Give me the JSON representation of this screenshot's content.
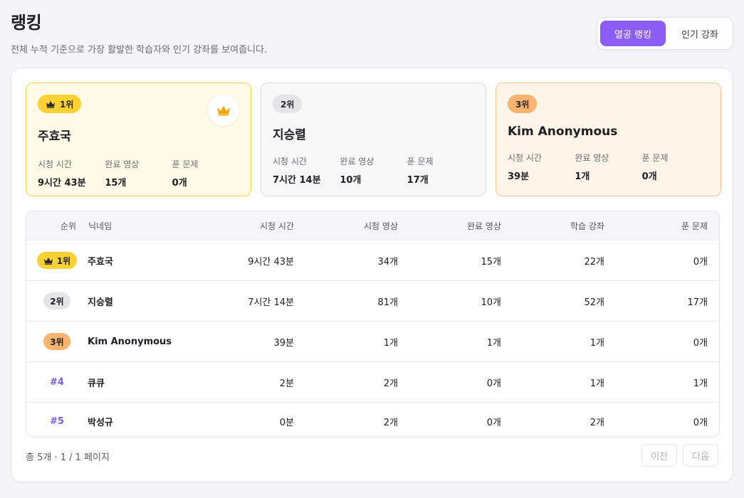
{
  "header": {
    "title": "랭킹",
    "subtitle": "전체 누적 기준으로 가장 활발한 학습자와 인기 강좌를 보여줍니다."
  },
  "tabs": [
    {
      "label": "열공 랭킹",
      "active": true
    },
    {
      "label": "인기 강좌",
      "active": false
    }
  ],
  "colors": {
    "accent": "#8b5cf6",
    "gold": "#fcd134",
    "silver": "#e5e5e8",
    "bronze": "#fbb370",
    "crown": "#f0a500"
  },
  "stat_labels": {
    "watch_time": "시청 시간",
    "completed": "완료 영상",
    "solved": "푼 문제"
  },
  "podium": [
    {
      "badge": "1위",
      "name": "주효국",
      "watch_time": "9시간 43분",
      "completed": "15개",
      "solved": "0개",
      "tier": "gold",
      "icon": "crown-icon"
    },
    {
      "badge": "2위",
      "name": "지승렬",
      "watch_time": "7시간 14분",
      "completed": "10개",
      "solved": "17개",
      "tier": "silver"
    },
    {
      "badge": "3위",
      "name": "Kim Anonymous",
      "watch_time": "39분",
      "completed": "1개",
      "solved": "0개",
      "tier": "bronze"
    }
  ],
  "table": {
    "columns": {
      "rank": "순위",
      "nickname": "닉네임",
      "watch_time": "시청 시간",
      "watched": "시청 영상",
      "completed": "완료 영상",
      "courses": "학습 강좌",
      "solved": "푼 문제"
    },
    "rows": [
      {
        "rank": "1위",
        "tier": "gold",
        "nickname": "주효국",
        "watch_time": "9시간 43분",
        "watched": "34개",
        "completed": "15개",
        "courses": "22개",
        "solved": "0개"
      },
      {
        "rank": "2위",
        "tier": "silver",
        "nickname": "지승렬",
        "watch_time": "7시간 14분",
        "watched": "81개",
        "completed": "10개",
        "courses": "52개",
        "solved": "17개"
      },
      {
        "rank": "3위",
        "tier": "bronze",
        "nickname": "Kim Anonymous",
        "watch_time": "39분",
        "watched": "1개",
        "completed": "1개",
        "courses": "1개",
        "solved": "0개"
      },
      {
        "rank": "#4",
        "tier": "none",
        "nickname": "큐큐",
        "watch_time": "2분",
        "watched": "2개",
        "completed": "0개",
        "courses": "1개",
        "solved": "1개"
      },
      {
        "rank": "#5",
        "tier": "none",
        "nickname": "박성규",
        "watch_time": "0분",
        "watched": "2개",
        "completed": "0개",
        "courses": "2개",
        "solved": "0개"
      }
    ]
  },
  "footer": {
    "summary": "총 5개 · 1 / 1 페이지",
    "prev": "이전",
    "next": "다음"
  }
}
